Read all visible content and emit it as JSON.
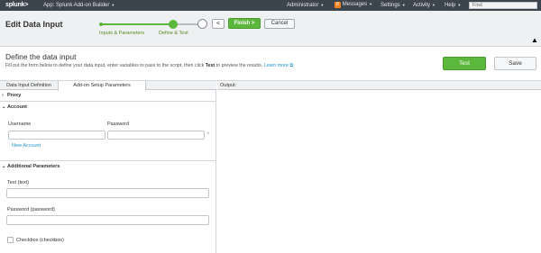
{
  "topbar": {
    "logo": "splunk>",
    "app": "App: Splunk Add-on Builder",
    "admin": "Administrator",
    "msg_count": "8",
    "messages": "Messages",
    "settings": "Settings",
    "activity": "Activity",
    "help": "Help",
    "find_placeholder": "Find"
  },
  "header": {
    "title": "Edit Data Input",
    "steps": [
      "Inputs & Parameters",
      "Define & Test"
    ],
    "prev_label": "<",
    "finish_label": "Finish >",
    "cancel_label": "Cancel"
  },
  "define": {
    "title": "Define the data input",
    "desc_pre": "Fill out the form below to define your data input, enter variables to pass to the script, then click ",
    "desc_bold": "Test",
    "desc_post": " to preview the results.",
    "learn_more": "Learn more",
    "test_label": "Test",
    "save_label": "Save"
  },
  "tabs": [
    "Data Input Definition",
    "Add-on Setup Parameters"
  ],
  "sections": {
    "proxy": "Proxy",
    "account": "Account",
    "additional": "Additional Parameters"
  },
  "account": {
    "username_label": "Username",
    "password_label": "Password",
    "new_account": "New Account"
  },
  "additional": {
    "text_label": "Text (text)",
    "password_label": "Password (password)",
    "checkbox_label": "Checkbox (checkbox)"
  },
  "output": {
    "label": "Output:"
  },
  "colors": {
    "topbar": "#3c444d",
    "accent_green": "#5cb83c",
    "link_blue": "#1e93c6",
    "badge_orange": "#f58220"
  }
}
